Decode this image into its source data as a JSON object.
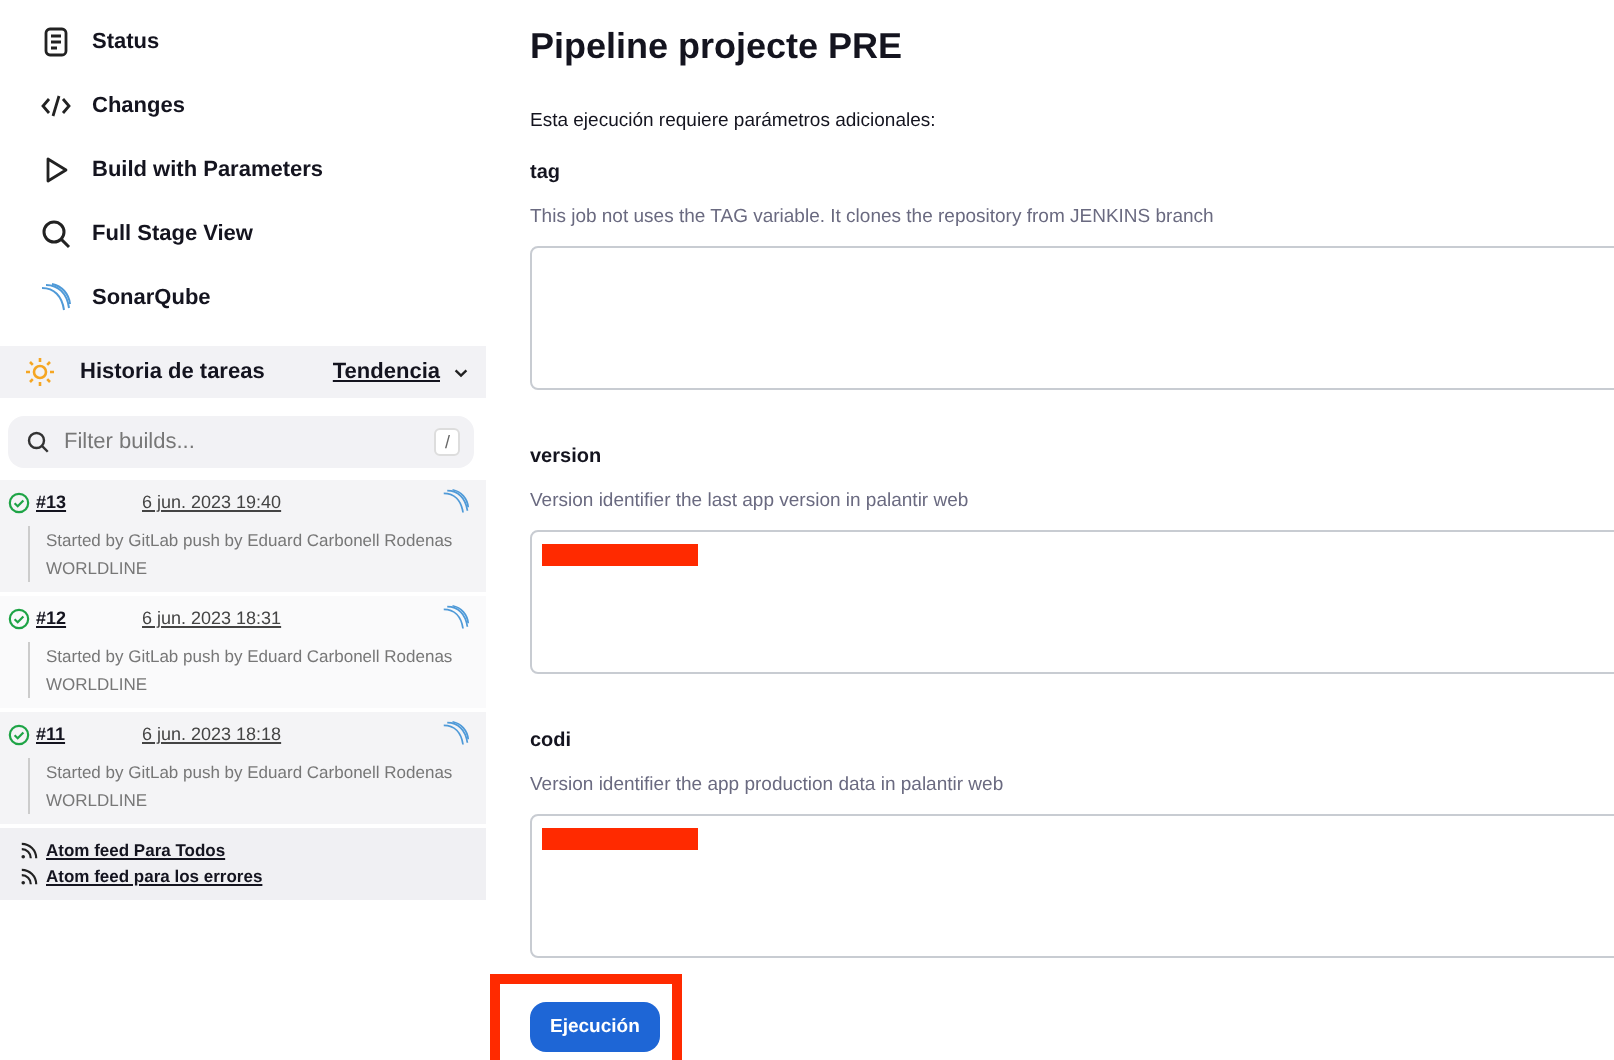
{
  "sidebar": {
    "items": [
      {
        "label": "Status",
        "kind": "status"
      },
      {
        "label": "Changes",
        "kind": "code"
      },
      {
        "label": "Build with Parameters",
        "kind": "play"
      },
      {
        "label": "Full Stage View",
        "kind": "search"
      },
      {
        "label": "SonarQube",
        "kind": "sonar"
      }
    ]
  },
  "build_history": {
    "title": "Historia de tareas",
    "trend": "Tendencia",
    "filter": {
      "placeholder": "Filter builds...",
      "shortcut": "/"
    },
    "builds": [
      {
        "number": "#13",
        "date": "6 jun. 2023 19:40",
        "description": "Started by GitLab push by Eduard Carbonell Rodenas",
        "user": "WORLDLINE",
        "succeeded": true
      },
      {
        "number": "#12",
        "date": "6 jun. 2023 18:31",
        "description": "Started by GitLab push by Eduard Carbonell Rodenas",
        "user": "WORLDLINE",
        "succeeded": true
      },
      {
        "number": "#11",
        "date": "6 jun. 2023 18:18",
        "description": "Started by GitLab push by Eduard Carbonell Rodenas",
        "user": "WORLDLINE",
        "succeeded": true
      }
    ],
    "feeds": [
      "Atom feed Para Todos",
      "Atom feed para los errores"
    ]
  },
  "main": {
    "title": "Pipeline projecte PRE",
    "intro": "Esta ejecución requiere parámetros adicionales:",
    "parameters": [
      {
        "name": "tag",
        "description": "This job not uses the TAG variable. It clones the repository from JENKINS branch",
        "redacted": false
      },
      {
        "name": "version",
        "description": "Version identifier the last app version in palantir web",
        "redacted": true
      },
      {
        "name": "codi",
        "description": "Version identifier the app production data in palantir web",
        "redacted": true
      }
    ],
    "submit": {
      "label": "Ejecución",
      "highlighted": true
    }
  }
}
